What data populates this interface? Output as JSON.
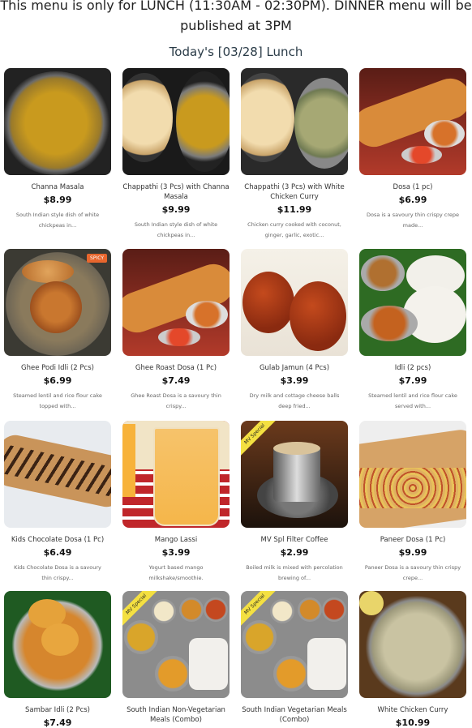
{
  "notice": "This menu is only for LUNCH (11:30AM - 02:30PM). DINNER menu will be published at 3PM",
  "today": "Today's [03/28] Lunch",
  "items": [
    {
      "name": "Channa Masala",
      "price": "$8.99",
      "desc": "South Indian style dish of white chickpeas in..."
    },
    {
      "name": "Chappathi (3 Pcs) with Channa Masala",
      "price": "$9.99",
      "desc": "South Indian style dish of white chickpeas in..."
    },
    {
      "name": "Chappathi (3 Pcs) with White Chicken Curry",
      "price": "$11.99",
      "desc": "Chicken curry cooked with coconut, ginger, garlic, exotic..."
    },
    {
      "name": "Dosa (1 pc)",
      "price": "$6.99",
      "desc": "Dosa is a savoury thin crispy crepe made..."
    },
    {
      "name": "Ghee Podi Idli (2 Pcs)",
      "price": "$6.99",
      "desc": "Steamed lentil and rice flour cake topped with...",
      "badge": "SPICY"
    },
    {
      "name": "Ghee Roast Dosa (1 Pc)",
      "price": "$7.49",
      "desc": "Ghee Roast Dosa is a savoury thin crispy..."
    },
    {
      "name": "Gulab Jamun (4 Pcs)",
      "price": "$3.99",
      "desc": "Dry milk and cottage cheese balls deep fried..."
    },
    {
      "name": "Idli (2 pcs)",
      "price": "$7.99",
      "desc": "Steamed lentil and rice flour cake served with..."
    },
    {
      "name": "Kids Chocolate Dosa (1 Pc)",
      "price": "$6.49",
      "desc": "Kids Chocolate Dosa is a savoury thin crispy..."
    },
    {
      "name": "Mango Lassi",
      "price": "$3.99",
      "desc": "Yogurt based mango milkshake/smoothie."
    },
    {
      "name": "MV Spl Filter Coffee",
      "price": "$2.99",
      "desc": "Boiled milk is mixed with percolation brewing of...",
      "corner": "MV Special"
    },
    {
      "name": "Paneer Dosa (1 Pc)",
      "price": "$9.99",
      "desc": "Paneer Dosa is a savoury thin crispy crepe..."
    },
    {
      "name": "Sambar Idli (2 Pcs)",
      "price": "$7.49",
      "desc": ""
    },
    {
      "name": "South Indian Non-Vegetarian Meals (Combo)",
      "price": "",
      "desc": "",
      "corner": "MV Special"
    },
    {
      "name": "South Indian Vegetarian Meals (Combo)",
      "price": "",
      "desc": "",
      "corner": "MV Special"
    },
    {
      "name": "White Chicken Curry",
      "price": "$10.99",
      "desc": ""
    }
  ]
}
